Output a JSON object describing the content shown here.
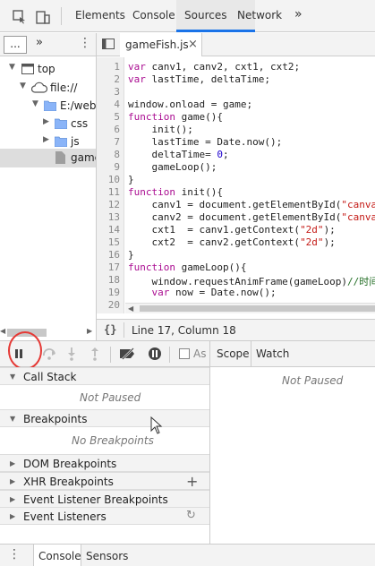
{
  "top_tabs": [
    "Elements",
    "Console",
    "Sources",
    "Network"
  ],
  "top_more": "»",
  "nav": {
    "more_btn": "...",
    "overflow": "»",
    "tree": [
      {
        "label": "top"
      },
      {
        "label": "file://"
      },
      {
        "label": "E:/web?"
      },
      {
        "label": "css"
      },
      {
        "label": "js"
      },
      {
        "label": "game"
      }
    ]
  },
  "editor": {
    "file_tab": "gameFish.js",
    "status": "Line 17, Column 18",
    "status_icon": "{}",
    "line_numbers": [
      "1",
      "2",
      "3",
      "4",
      "5",
      "6",
      "7",
      "8",
      "9",
      "10",
      "11",
      "12",
      "13",
      "14",
      "15",
      "16",
      "17",
      "18",
      "19",
      "20"
    ]
  },
  "debugger": {
    "async_label": "As",
    "call_stack": "Call Stack",
    "call_stack_empty": "Not Paused",
    "breakpoints": "Breakpoints",
    "breakpoints_empty": "No Breakpoints",
    "dom_breakpoints": "DOM Breakpoints",
    "xhr_breakpoints": "XHR Breakpoints",
    "event_listener_breakpoints": "Event Listener Breakpoints",
    "event_listeners": "Event Listeners",
    "scope_tab": "Scope",
    "watch_tab": "Watch",
    "scope_empty": "Not Paused"
  },
  "bottom_tabs": [
    "Console",
    "Sensors"
  ],
  "colors": {
    "accent": "#1a73e8",
    "annotation": "#e53935"
  }
}
